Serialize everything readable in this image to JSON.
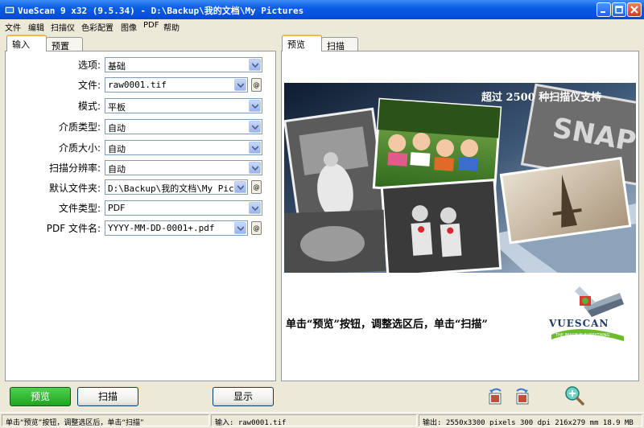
{
  "window": {
    "title": "VueScan 9 x32 (9.5.34) - D:\\Backup\\我的文档\\My Pictures"
  },
  "menu": [
    "文件",
    "编辑",
    "扫描仪",
    "色彩配置",
    "图像",
    "PDF",
    "帮助"
  ],
  "left_tabs": [
    "输入",
    "预置"
  ],
  "form": {
    "rows": [
      {
        "label": "选项:",
        "value": "基础",
        "browse": false
      },
      {
        "label": "文件:",
        "value": "raw0001.tif",
        "browse": true
      },
      {
        "label": "模式:",
        "value": "平板",
        "browse": false
      },
      {
        "label": "介质类型:",
        "value": "自动",
        "browse": false
      },
      {
        "label": "介质大小:",
        "value": "自动",
        "browse": false
      },
      {
        "label": "扫描分辨率:",
        "value": "自动",
        "browse": false
      },
      {
        "label": "默认文件夹:",
        "value": "D:\\Backup\\我的文档\\My Pic",
        "browse": true
      },
      {
        "label": "文件类型:",
        "value": "PDF",
        "browse": false
      },
      {
        "label": "PDF 文件名:",
        "value": "YYYY-MM-DD-0001+.pdf",
        "browse": true
      }
    ],
    "browse_label": "@"
  },
  "right_tabs": [
    "预览",
    "扫描"
  ],
  "preview": {
    "banner_text": "超过 2500 种扫描仪支持",
    "hint": "单击“预览”按钮，调整选区后，单击“扫描”",
    "logo_name": "VUESCAN",
    "logo_tagline": "THE IMAGE IS EVERYTHING",
    "snap_text": "SNAP"
  },
  "buttons": {
    "preview": "预览",
    "scan": "扫描",
    "show": "显示"
  },
  "status": {
    "hint": "单击“预览”按钮，调整选区后，单击“扫描”",
    "input": "输入: raw0001.tif",
    "output": "输出: 2550x3300 pixels 300 dpi 216x279 mm 18.9 MB"
  },
  "colors": {
    "titlebar": "#0a5ee5",
    "preview_button": "#1fa51f",
    "tab_highlight": "#f5b642"
  }
}
